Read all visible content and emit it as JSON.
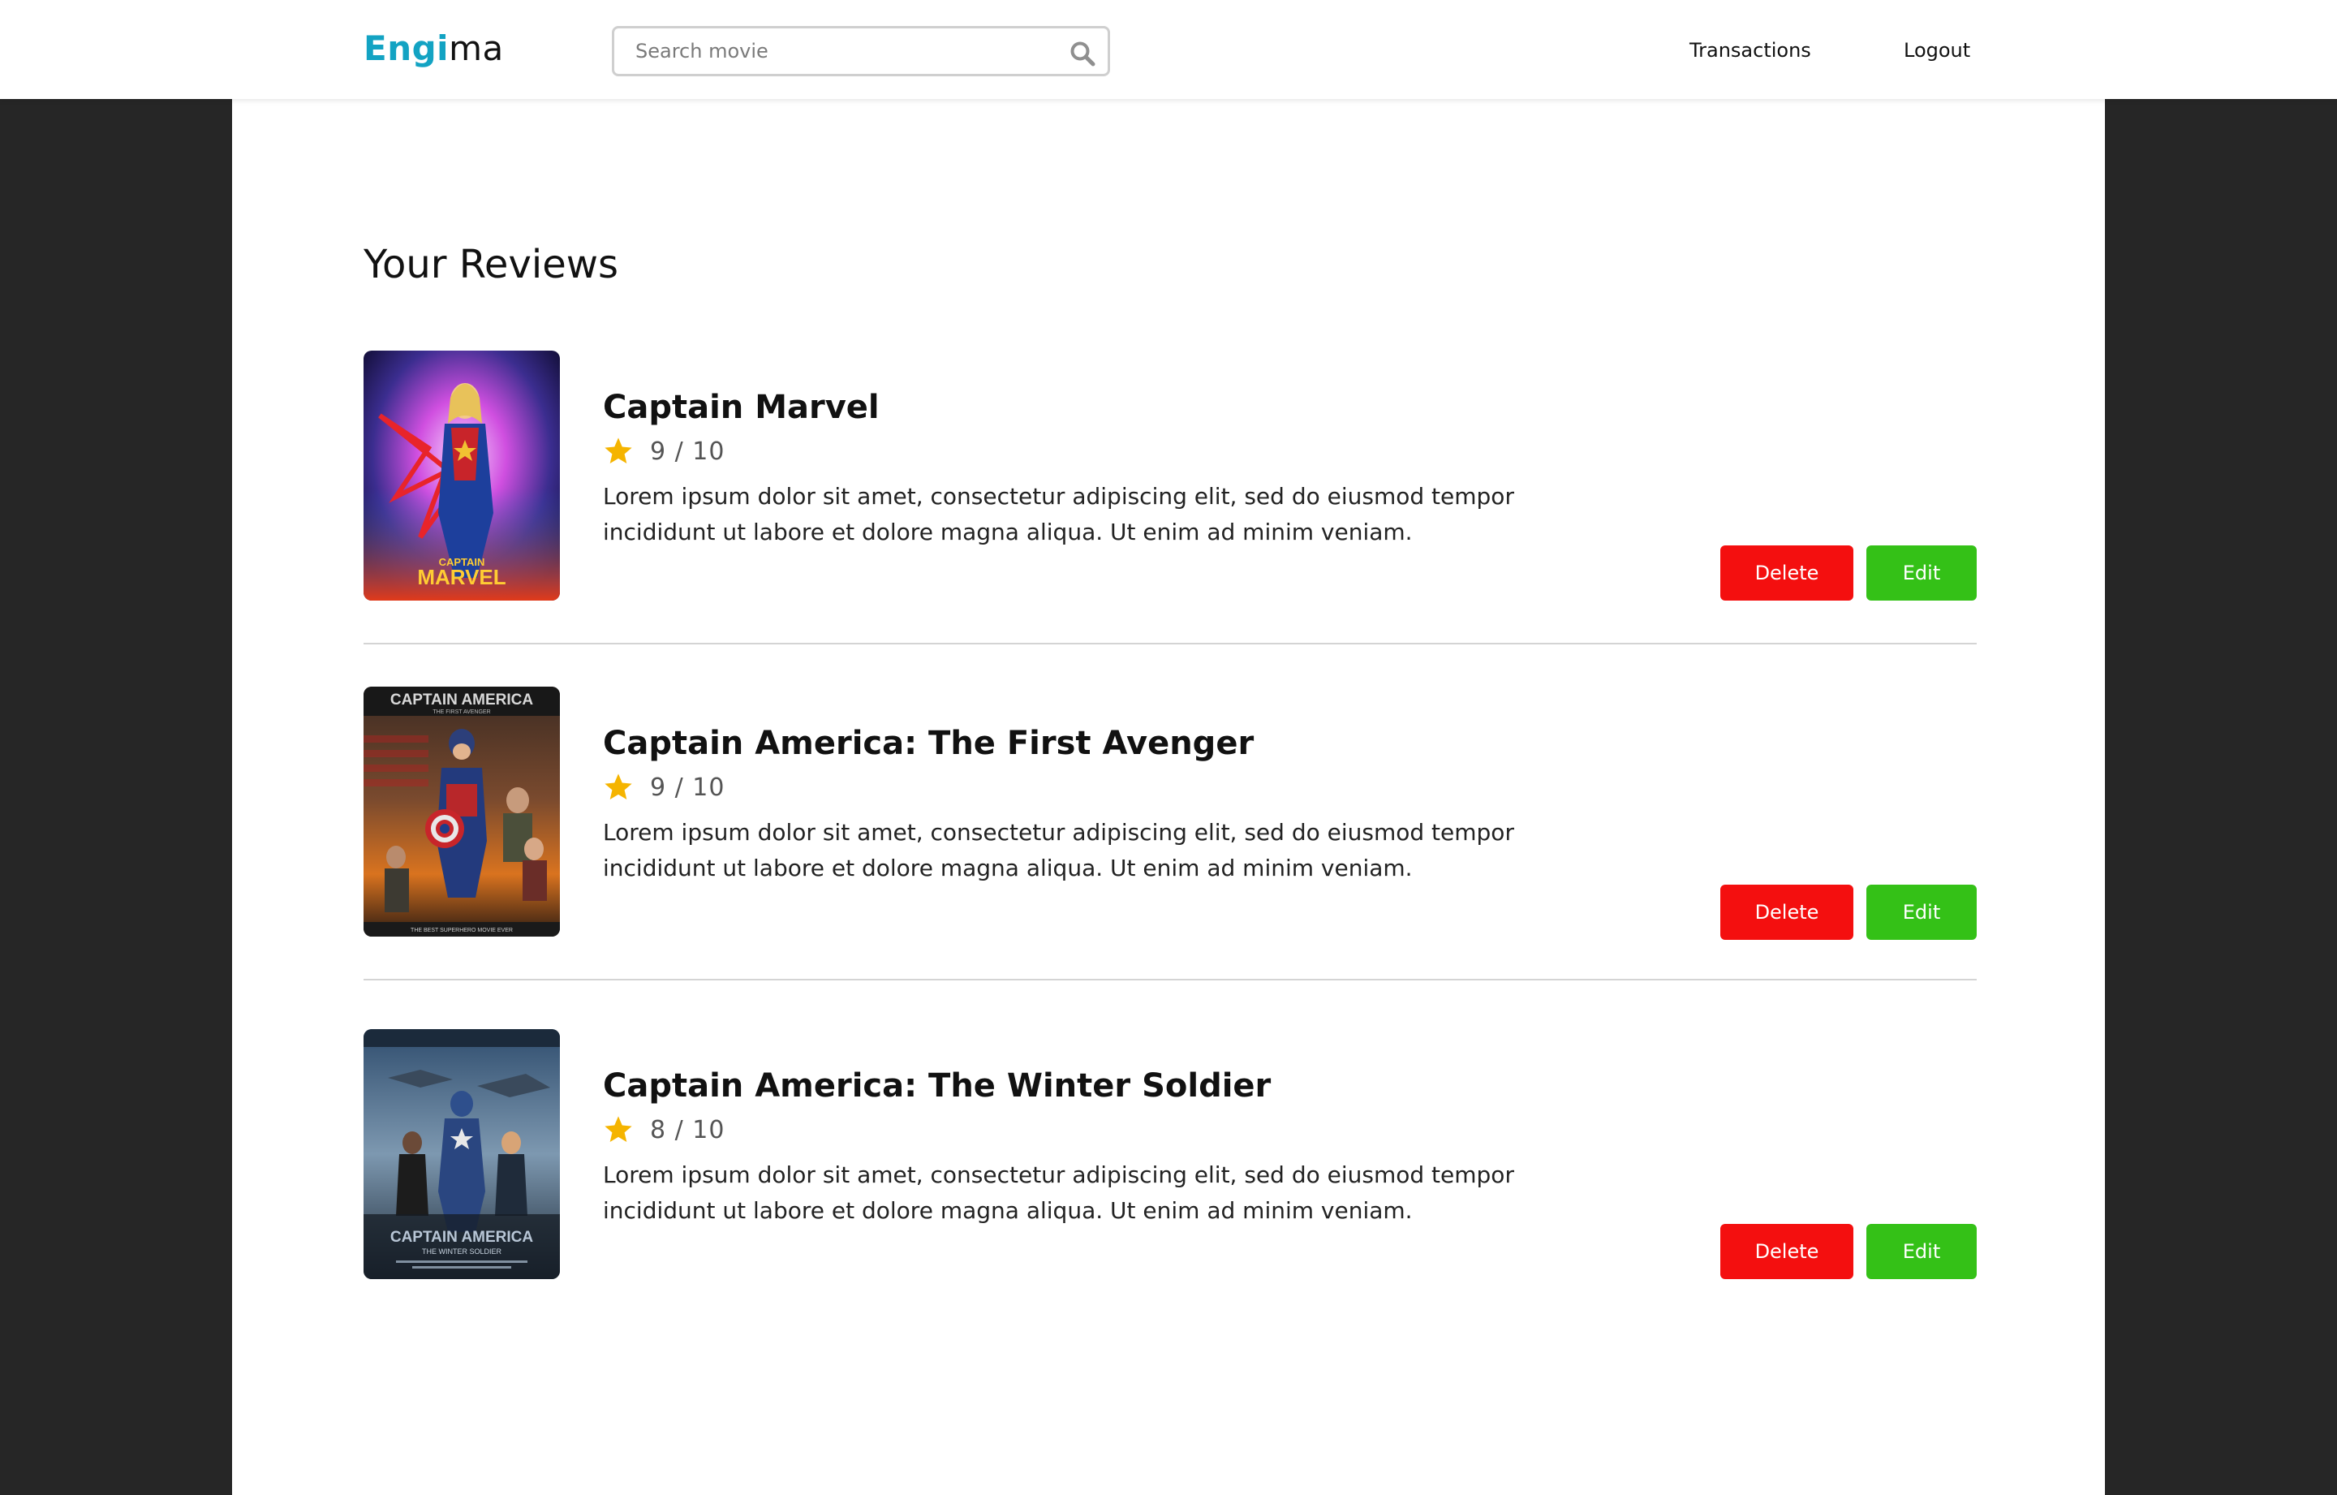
{
  "header": {
    "logo_accent": "Engi",
    "logo_rest": "ma",
    "search_placeholder": "Search movie",
    "search_value": "",
    "search_icon": "magnifier-icon",
    "nav": {
      "transactions": "Transactions",
      "logout": "Logout"
    }
  },
  "page": {
    "title": "Your Reviews"
  },
  "colors": {
    "brand_accent": "#13a3c3",
    "delete_button": "#f40f0f",
    "edit_button": "#34c117",
    "star": "#f5b400",
    "page_background": "#262626"
  },
  "reviews": [
    {
      "title": "Captain Marvel",
      "rating": "9 / 10",
      "text": "Lorem ipsum dolor sit amet, consectetur adipiscing elit, sed do eiusmod tempor incididunt ut labore et dolore magna aliqua. Ut enim ad minim veniam.",
      "poster_icon": "captain-marvel-poster",
      "poster_caption": "CAPTAIN MARVEL",
      "delete_label": "Delete",
      "edit_label": "Edit"
    },
    {
      "title": "Captain America: The First Avenger",
      "rating": "9 / 10",
      "text": "Lorem ipsum dolor sit amet, consectetur adipiscing elit, sed do eiusmod tempor incididunt ut labore et dolore magna aliqua. Ut enim ad minim veniam.",
      "poster_icon": "captain-america-first-avenger-poster",
      "poster_caption": "CAPTAIN AMERICA",
      "delete_label": "Delete",
      "edit_label": "Edit"
    },
    {
      "title": "Captain America: The Winter Soldier",
      "rating": "8 / 10",
      "text": "Lorem ipsum dolor sit amet, consectetur adipiscing elit, sed do eiusmod tempor incididunt ut labore et dolore magna aliqua. Ut enim ad minim veniam.",
      "poster_icon": "captain-america-winter-soldier-poster",
      "poster_caption": "CAPTAIN AMERICA",
      "delete_label": "Delete",
      "edit_label": "Edit"
    }
  ]
}
